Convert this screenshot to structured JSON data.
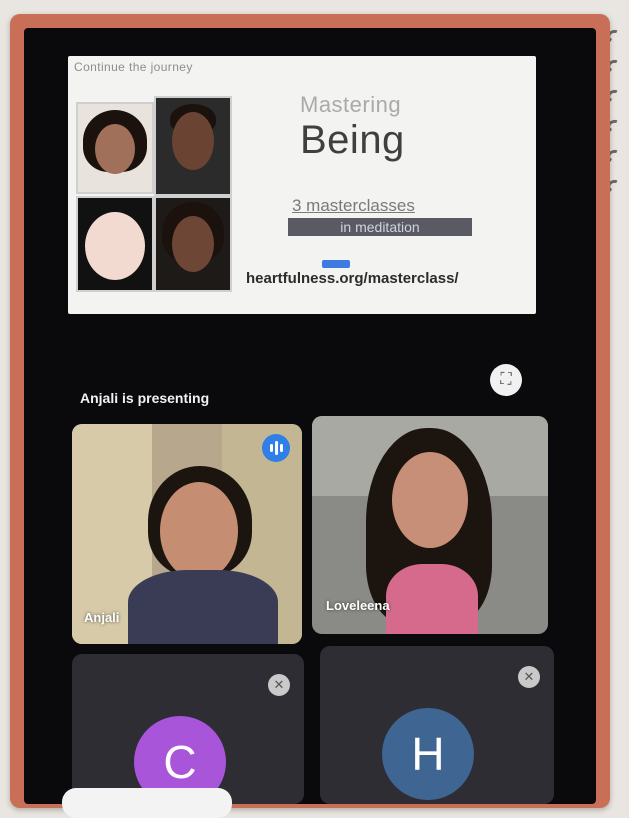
{
  "slide": {
    "top_text": "Continue the journey",
    "title_small": "Mastering",
    "title_big": "Being",
    "subtitle_line1": "3 masterclasses",
    "subtitle_line2": "in meditation",
    "url": "heartfulness.org/masterclass/"
  },
  "presenting_label": "Anjali is presenting",
  "fullscreen_icon": "fullscreen-icon",
  "participants": [
    {
      "name": "Anjali",
      "state": "speaking"
    },
    {
      "name": "Loveleena",
      "state": "video"
    },
    {
      "initial": "C",
      "avatar_color": "#a855d9",
      "state": "muted"
    },
    {
      "initial": "H",
      "avatar_color": "#3f6592",
      "state": "muted"
    }
  ],
  "colors": {
    "speaking_badge": "#2f7fe6",
    "frame": "#c96f58",
    "screen_bg": "#0a0a0d"
  }
}
